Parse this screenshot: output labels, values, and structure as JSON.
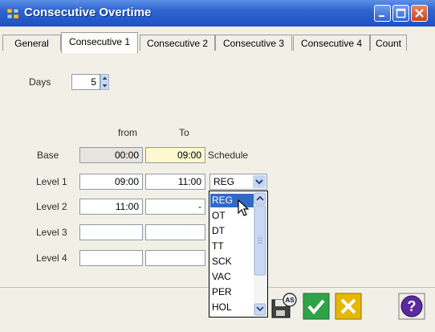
{
  "window": {
    "title": "Consecutive Overtime"
  },
  "tabs": [
    "General",
    "Consecutive 1",
    "Consecutive 2",
    "Consecutive 3",
    "Consecutive 4",
    "Count"
  ],
  "days": {
    "label": "Days",
    "value": "5"
  },
  "columns": {
    "from": "from",
    "to": "To"
  },
  "rows": {
    "base": {
      "label": "Base",
      "from": "00:00",
      "to": "09:00",
      "extra": "Schedule"
    },
    "level1": {
      "label": "Level 1",
      "from": "09:00",
      "to": "11:00",
      "code": "REG"
    },
    "level2": {
      "label": "Level 2",
      "from": "11:00",
      "to": "-"
    },
    "level3": {
      "label": "Level 3",
      "from": "",
      "to": ""
    },
    "level4": {
      "label": "Level 4",
      "from": "",
      "to": ""
    }
  },
  "dropdown": {
    "options": [
      "REG",
      "OT",
      "DT",
      "TT",
      "SCK",
      "VAC",
      "PER",
      "HOL"
    ],
    "selected": "REG"
  },
  "icons": [
    "save-as-icon",
    "ok-check-icon",
    "cancel-x-icon",
    "help-icon",
    "minimize-icon",
    "maximize-icon",
    "close-icon"
  ],
  "colors": {
    "titlebar": "#2e63d0",
    "selection": "#316ac5",
    "base_to_bg": "#fdf8cf",
    "ok": "#2fa34a",
    "cancel": "#e5b700"
  }
}
